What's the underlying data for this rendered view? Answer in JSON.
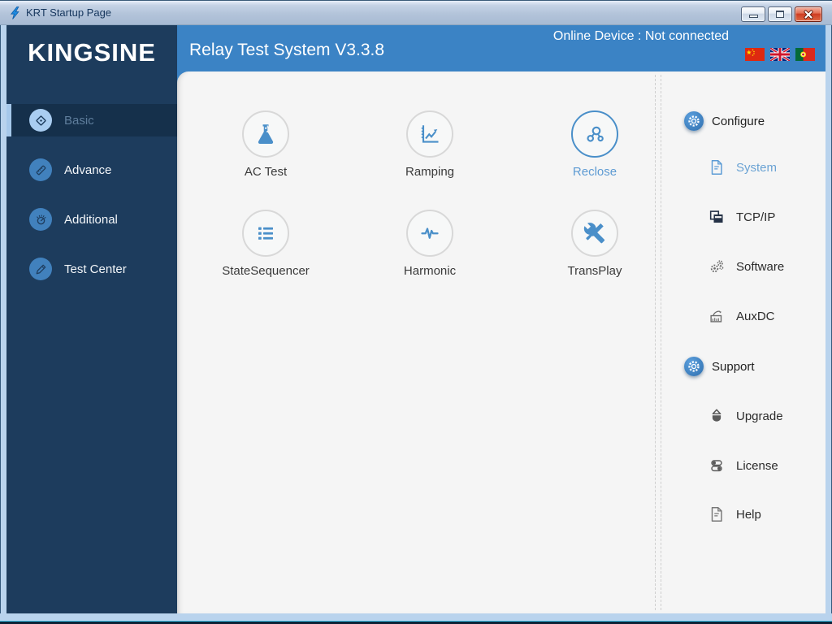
{
  "window": {
    "title": "KRT Startup Page",
    "controls": {
      "minimize": "minimize-button",
      "maximize": "maximize-button",
      "close": "close-button"
    }
  },
  "brand": {
    "logo": "KINGSINE"
  },
  "header": {
    "title": "Relay Test System V3.3.8",
    "status": "Online Device : Not connected",
    "languages": [
      {
        "name": "chinese",
        "icon": "china-flag-icon"
      },
      {
        "name": "english",
        "icon": "uk-flag-icon"
      },
      {
        "name": "portuguese",
        "icon": "portugal-flag-icon"
      }
    ]
  },
  "sidebar": {
    "items": [
      {
        "label": "Basic",
        "icon": "gem-icon",
        "active": true
      },
      {
        "label": "Advance",
        "icon": "ruler-icon",
        "active": false
      },
      {
        "label": "Additional",
        "icon": "gauge-icon",
        "active": false
      },
      {
        "label": "Test Center",
        "icon": "pencil-icon",
        "active": false
      }
    ]
  },
  "main": {
    "tiles": [
      {
        "label": "AC Test",
        "icon": "flask-icon",
        "highlighted": false
      },
      {
        "label": "Ramping",
        "icon": "trend-chart-icon",
        "highlighted": false
      },
      {
        "label": "Reclose",
        "icon": "nodes-icon",
        "highlighted": true
      },
      {
        "label": "StateSequencer",
        "icon": "list-icon",
        "highlighted": false
      },
      {
        "label": "Harmonic",
        "icon": "pulse-icon",
        "highlighted": false
      },
      {
        "label": "TransPlay",
        "icon": "tools-icon",
        "highlighted": false
      }
    ]
  },
  "panel": {
    "groups": [
      {
        "label": "Configure",
        "icon": "gear-badge-icon",
        "items": [
          {
            "label": "System",
            "icon": "document-icon",
            "active": true
          },
          {
            "label": "TCP/IP",
            "icon": "drive-icon",
            "active": false
          },
          {
            "label": "Software",
            "icon": "gears-icon",
            "active": false
          },
          {
            "label": "AuxDC",
            "icon": "chart-arrow-icon",
            "active": false
          }
        ]
      },
      {
        "label": "Support",
        "icon": "gear-badge-icon",
        "items": [
          {
            "label": "Upgrade",
            "icon": "upgrade-icon",
            "active": false
          },
          {
            "label": "License",
            "icon": "toggles-icon",
            "active": false
          },
          {
            "label": "Help",
            "icon": "document-icon",
            "active": false
          }
        ]
      }
    ]
  },
  "colors": {
    "headerBlue": "#3b83c5",
    "sidebarNavy": "#1d3c5d",
    "sidebarActive": "#15304b",
    "accentBlue": "#4a8fc9",
    "activeItemText": "#6ba3d4",
    "panelBg": "#f5f5f5",
    "frameBlue": "#b9d3ed",
    "closeRed": "#cd3a20"
  }
}
